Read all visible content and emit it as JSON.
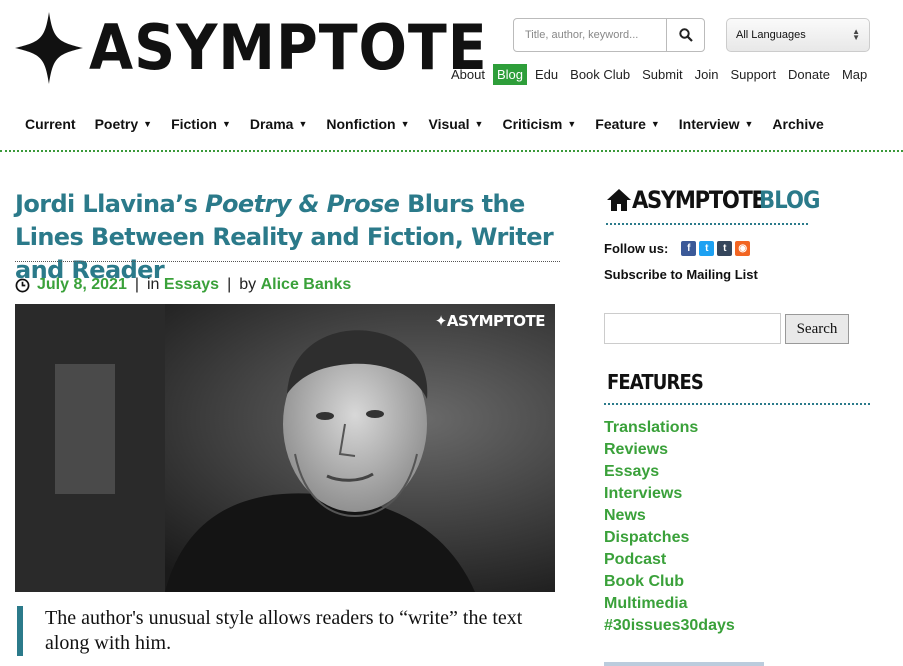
{
  "header": {
    "logo_text": "ASYMPTOTE",
    "search": {
      "placeholder": "Title, author, keyword..."
    },
    "language": {
      "selected": "All Languages"
    },
    "top_nav": [
      "About",
      "Blog",
      "Edu",
      "Book Club",
      "Submit",
      "Join",
      "Support",
      "Donate",
      "Map"
    ],
    "active_top_nav": "Blog"
  },
  "main_nav": [
    {
      "label": "Current",
      "dropdown": false
    },
    {
      "label": "Poetry",
      "dropdown": true
    },
    {
      "label": "Fiction",
      "dropdown": true
    },
    {
      "label": "Drama",
      "dropdown": true
    },
    {
      "label": "Nonfiction",
      "dropdown": true
    },
    {
      "label": "Visual",
      "dropdown": true
    },
    {
      "label": "Criticism",
      "dropdown": true
    },
    {
      "label": "Feature",
      "dropdown": true
    },
    {
      "label": "Interview",
      "dropdown": true
    },
    {
      "label": "Archive",
      "dropdown": false
    }
  ],
  "article": {
    "title_pre": "Jordi Llavina’s ",
    "title_em": "Poetry & Prose",
    "title_post": " Blurs the Lines Between Reality and Fiction, Writer and Reader",
    "date": "July 8, 2021",
    "in_label": "in",
    "category": "Essays",
    "by_label": "by",
    "author": "Alice Banks",
    "image_watermark": "ASYMPTOTE",
    "pull_quote": "The author's unusual style allows readers to “write” the text along with him."
  },
  "sidebar": {
    "blog_logo_a": "ASYMPTOTE",
    "blog_logo_b": "BLOG",
    "follow_label": "Follow us:",
    "social": [
      "facebook-icon",
      "twitter-icon",
      "tumblr-icon",
      "rss-icon"
    ],
    "subscribe": "Subscribe to Mailing List",
    "search_button": "Search",
    "features_title": "FEATURES",
    "features": [
      "Translations",
      "Reviews",
      "Essays",
      "Interviews",
      "News",
      "Dispatches",
      "Podcast",
      "Book Club",
      "Multimedia",
      "#30issues30days"
    ]
  },
  "colors": {
    "teal": "#2b7a8a",
    "green": "#3aa13a",
    "active_nav": "#2e9e3a"
  }
}
